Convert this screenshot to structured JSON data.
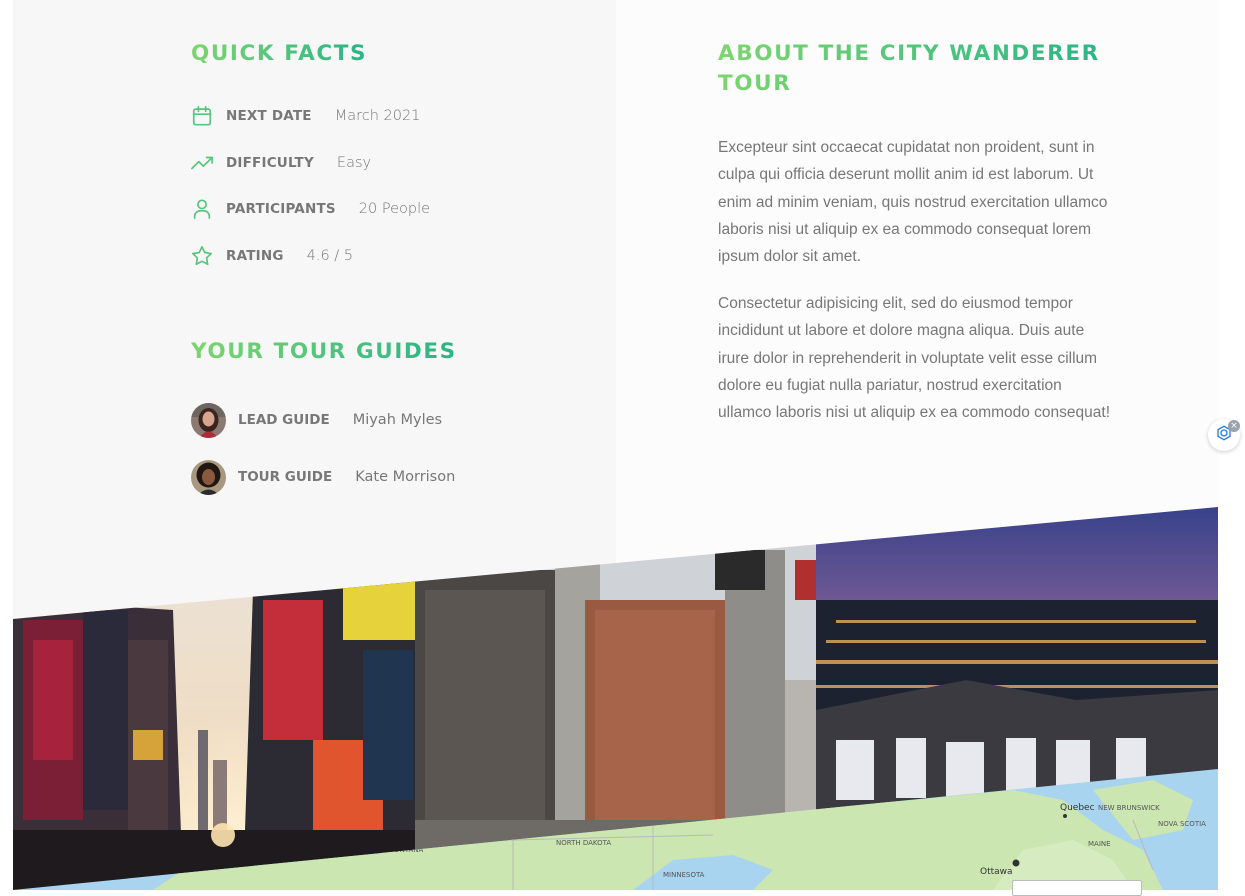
{
  "quick_facts": {
    "title": "Quick facts",
    "items": [
      {
        "icon": "calendar-icon",
        "label": "NEXT DATE",
        "value": "March 2021"
      },
      {
        "icon": "trending-up-icon",
        "label": "DIFFICULTY",
        "value": "Easy"
      },
      {
        "icon": "user-icon",
        "label": "PARTICIPANTS",
        "value": "20 People"
      },
      {
        "icon": "star-icon",
        "label": "RATING",
        "value": "4.6 / 5"
      }
    ]
  },
  "guides": {
    "title": "Your tour guides",
    "items": [
      {
        "role": "LEAD GUIDE",
        "name": "Miyah Myles"
      },
      {
        "role": "TOUR GUIDE",
        "name": "Kate Morrison"
      }
    ]
  },
  "about": {
    "title": "About the City Wanderer Tour",
    "paragraphs": [
      "Excepteur sint occaecat cupidatat non proident, sunt in culpa qui officia deserunt mollit anim id est laborum. Ut enim ad minim veniam, quis nostrud exercitation ullamco laboris nisi ut aliquip ex ea commodo consequat lorem ipsum dolor sit amet.",
      "Consectetur adipisicing elit, sed do eiusmod tempor incididunt ut labore et dolore magna aliqua. Duis aute irure dolor in reprehenderit in voluptate velit esse cillum dolore eu fugiat nulla pariatur, nostrud exercitation ullamco laboris nisi ut aliquip ex ea commodo consequat!"
    ]
  },
  "map": {
    "labels": {
      "quebec": "Quebec",
      "new_brunswick": "NEW BRUNSWICK",
      "nova_scotia": "NOVA SCOTIA",
      "maine": "MAINE",
      "ottawa": "Ottawa",
      "north_dakota": "NORTH DAKOTA",
      "minnesota": "MINNESOTA",
      "montana": "MONTANA"
    }
  },
  "colors": {
    "accent_start": "#7dd56f",
    "accent_end": "#28b487",
    "text": "#777777"
  }
}
